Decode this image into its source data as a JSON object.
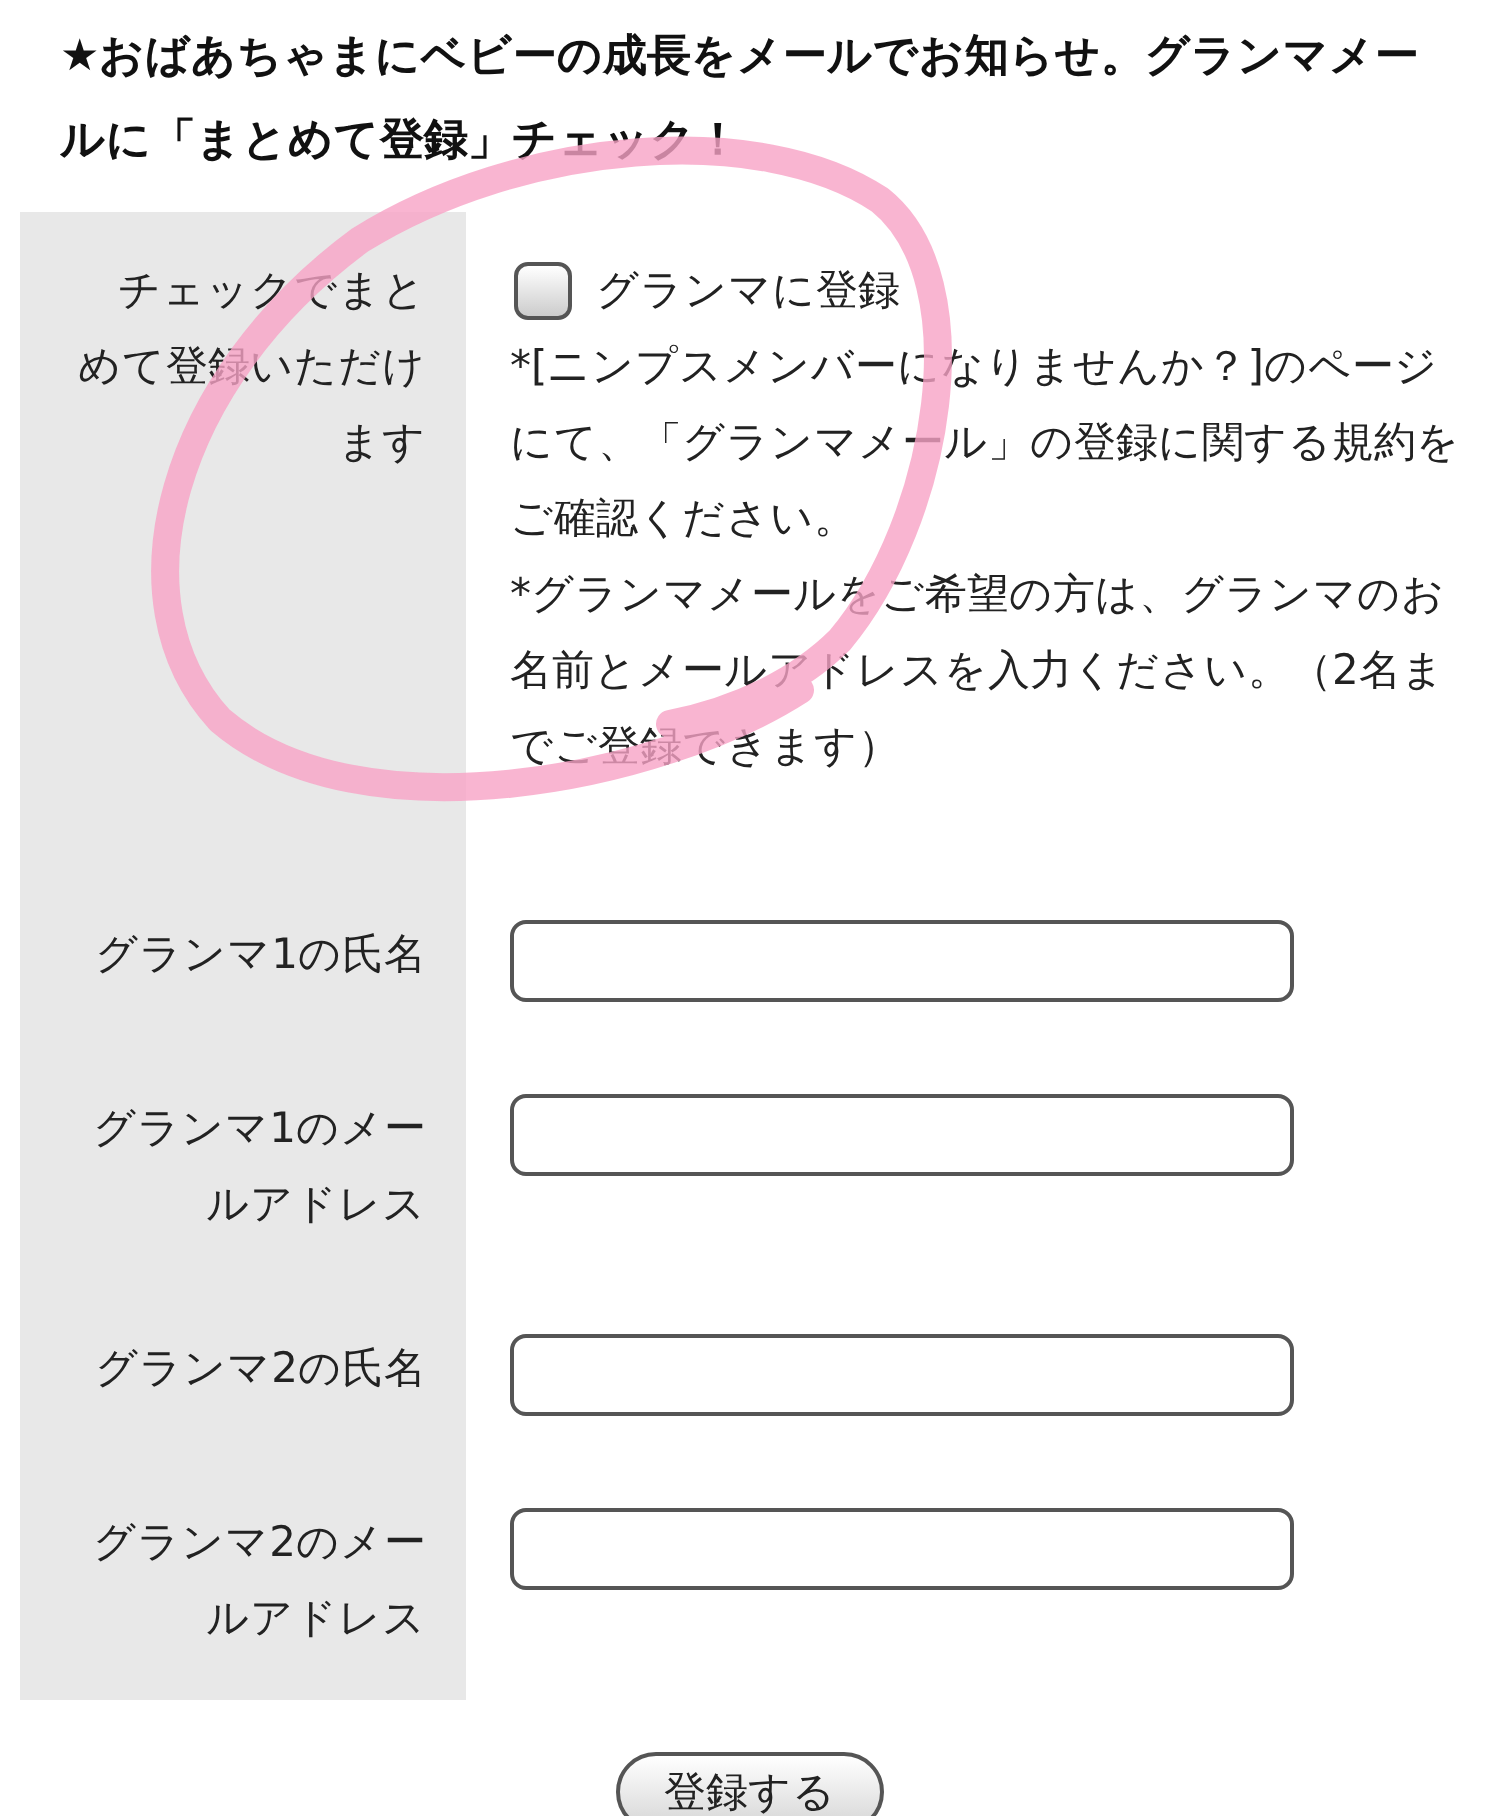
{
  "heading": "★おばあちゃまにベビーの成長をメールでお知らせ。グランマメールに「まとめて登録」チェック！",
  "form": {
    "rows": [
      {
        "kind": "checkbox",
        "label": "チェックでまとめて登録いただけます",
        "checkbox": {
          "label": "グランマに登録",
          "checked": false
        },
        "notes": [
          "*[ニンプスメンバーになりませんか？]のページにて、「グランマメール」の登録に関する規約をご確認ください。",
          "*グランマメールをご希望の方は、グランマのお名前とメールアドレスを入力ください。（2名までご登録できます）"
        ]
      },
      {
        "kind": "text",
        "label": "グランマ1の氏名"
      },
      {
        "kind": "text",
        "label": "グランマ1のメールアドレス"
      },
      {
        "kind": "text",
        "label": "グランマ2の氏名"
      },
      {
        "kind": "text",
        "label": "グランマ2のメールアドレス"
      }
    ]
  },
  "submit": "登録する"
}
